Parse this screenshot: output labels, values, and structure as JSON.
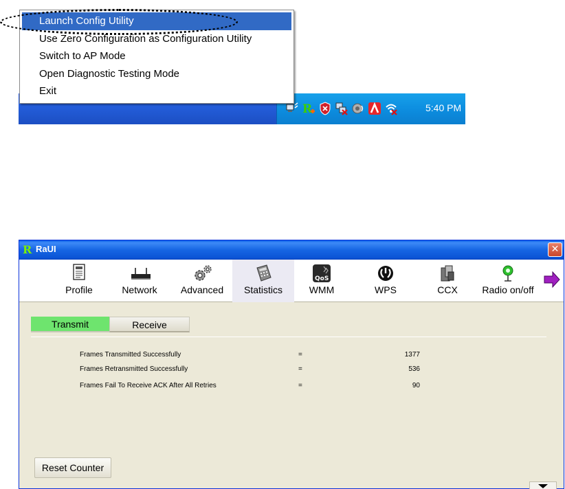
{
  "context_menu": {
    "items": [
      {
        "label": "Launch Config Utility",
        "selected": true
      },
      {
        "label": "Use Zero Configuration as Configuration Utility",
        "selected": false
      },
      {
        "label": "Switch to AP Mode",
        "selected": false
      },
      {
        "label": "Open Diagnostic Testing Mode",
        "selected": false
      },
      {
        "label": "Exit",
        "selected": false
      }
    ]
  },
  "taskbar": {
    "clock": "5:40 PM",
    "tray_icons": [
      "network-icon",
      "ralink-icon",
      "shield-icon",
      "network-disconnected-icon",
      "volume-icon",
      "antivirus-icon",
      "wireless-icon"
    ]
  },
  "window": {
    "title": "RaUI",
    "toolbar": [
      {
        "label": "Profile",
        "icon": "profile-icon"
      },
      {
        "label": "Network",
        "icon": "router-icon"
      },
      {
        "label": "Advanced",
        "icon": "gears-icon"
      },
      {
        "label": "Statistics",
        "icon": "calculator-icon",
        "active": true
      },
      {
        "label": "WMM",
        "icon": "qos-icon"
      },
      {
        "label": "WPS",
        "icon": "wps-icon"
      },
      {
        "label": "CCX",
        "icon": "ccx-icon"
      },
      {
        "label": "Radio on/off",
        "icon": "radio-icon"
      }
    ],
    "tabs": {
      "transmit": "Transmit",
      "receive": "Receive"
    },
    "stats": [
      {
        "label": "Frames Transmitted Successfully",
        "eq": "=",
        "value": "1377"
      },
      {
        "label": "Frames Retransmitted Successfully",
        "eq": "=",
        "value": "536"
      },
      {
        "label": "Frames Fail To Receive ACK After All Retries",
        "eq": "=",
        "value": "90"
      }
    ],
    "reset_button": "Reset Counter"
  },
  "colors": {
    "menu_highlight": "#316ac5",
    "active_tab": "#6ee46e",
    "taskbar": "#245edb",
    "tray": "#0d8ee0"
  }
}
